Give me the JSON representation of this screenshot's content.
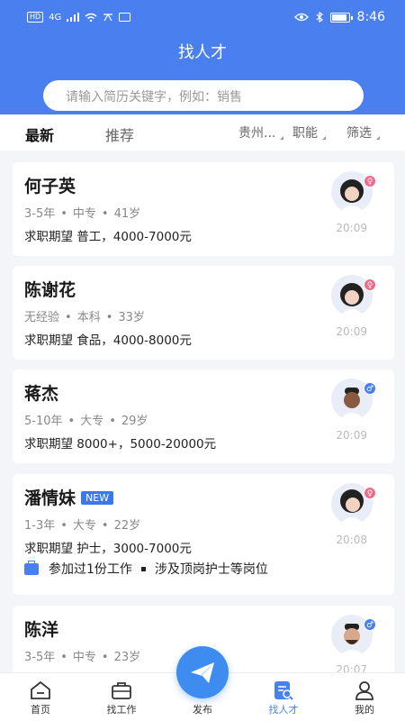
{
  "status_bar": {
    "left_badges": [
      "HD",
      "4G"
    ],
    "time": "8:46"
  },
  "header": {
    "title": "找人才"
  },
  "search": {
    "placeholder": "请输入简历关键字，例如：销售"
  },
  "tabs": [
    {
      "label": "最新"
    },
    {
      "label": "推荐"
    }
  ],
  "filters": [
    {
      "label": "贵州..."
    },
    {
      "label": "职能"
    },
    {
      "label": "筛选"
    }
  ],
  "candidates": [
    {
      "name": "何子英",
      "experience": "3-5年",
      "education": "中专",
      "age": "41岁",
      "expectation": "求职期望 普工，4000-7000元",
      "time": "20:09",
      "gender": "female"
    },
    {
      "name": "陈谢花",
      "experience": "无经验",
      "education": "本科",
      "age": "33岁",
      "expectation": "求职期望 食品，4000-8000元",
      "time": "20:09",
      "gender": "female"
    },
    {
      "name": "蒋杰",
      "experience": "5-10年",
      "education": "大专",
      "age": "29岁",
      "expectation": "求职期望 8000+，5000-20000元",
      "time": "20:09",
      "gender": "male"
    },
    {
      "name": "潘情妹",
      "badge": "NEW",
      "experience": "1-3年",
      "education": "大专",
      "age": "22岁",
      "expectation": "求职期望 护士，3000-7000元",
      "extra_a": "参加过1份工作",
      "extra_b": "涉及顶岗护士等岗位",
      "time": "20:08",
      "gender": "female"
    },
    {
      "name": "陈洋",
      "experience": "3-5年",
      "education": "中专",
      "age": "23岁",
      "time": "20:07",
      "gender": "male"
    }
  ],
  "tabbar": [
    {
      "label": "首页",
      "icon": "home-icon"
    },
    {
      "label": "找工作",
      "icon": "briefcase-icon"
    },
    {
      "label": "发布",
      "icon": "paper-plane-icon"
    },
    {
      "label": "找人才",
      "icon": "talent-search-icon",
      "active": true
    },
    {
      "label": "我的",
      "icon": "person-icon"
    }
  ],
  "colors": {
    "primary": "#4a7ff0",
    "female": "#f06a8a",
    "male": "#4a7ff0"
  }
}
